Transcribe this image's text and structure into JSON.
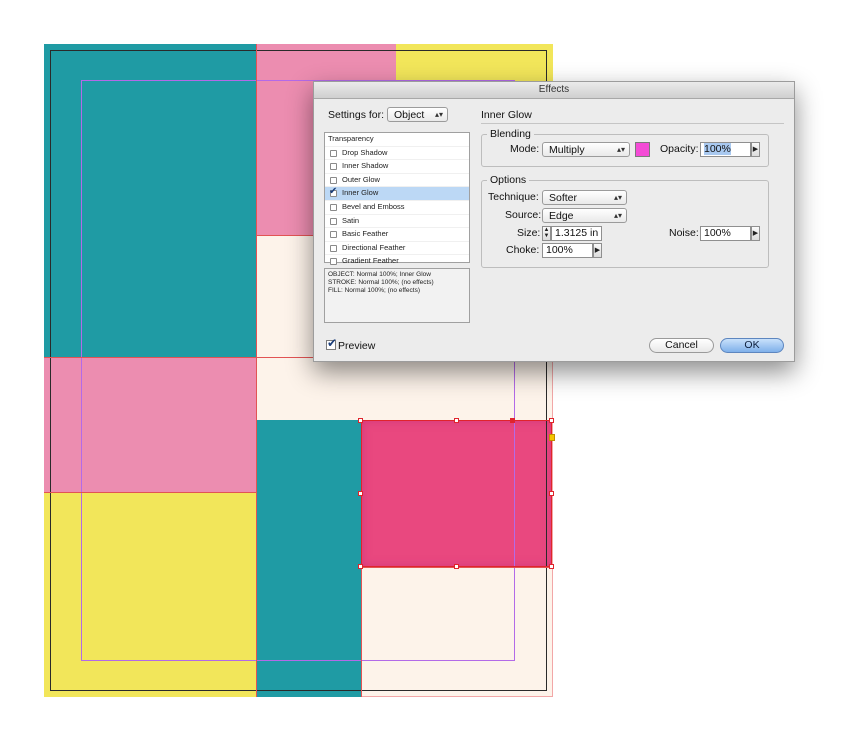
{
  "colors": {
    "teal": "#1f9ba4",
    "pink": "#ec8db0",
    "yellow": "#f2e65a",
    "cream": "#fdf3ea",
    "hot_pink": "#e9487f",
    "glow_swatch": "#f44bd6"
  },
  "dialog": {
    "title": "Effects",
    "settings_for_label": "Settings for:",
    "settings_for_value": "Object",
    "panel_title": "Inner Glow",
    "effects_list": [
      {
        "label": "Transparency",
        "checkbox": false,
        "checked": false,
        "selected": false
      },
      {
        "label": "Drop Shadow",
        "checkbox": true,
        "checked": false,
        "selected": false
      },
      {
        "label": "Inner Shadow",
        "checkbox": true,
        "checked": false,
        "selected": false
      },
      {
        "label": "Outer Glow",
        "checkbox": true,
        "checked": false,
        "selected": false
      },
      {
        "label": "Inner Glow",
        "checkbox": true,
        "checked": true,
        "selected": true
      },
      {
        "label": "Bevel and Emboss",
        "checkbox": true,
        "checked": false,
        "selected": false
      },
      {
        "label": "Satin",
        "checkbox": true,
        "checked": false,
        "selected": false
      },
      {
        "label": "Basic Feather",
        "checkbox": true,
        "checked": false,
        "selected": false
      },
      {
        "label": "Directional Feather",
        "checkbox": true,
        "checked": false,
        "selected": false
      },
      {
        "label": "Gradient Feather",
        "checkbox": true,
        "checked": false,
        "selected": false
      }
    ],
    "summary_lines": [
      "OBJECT: Normal 100%; Inner Glow",
      "STROKE: Normal 100%; (no effects)",
      "FILL: Normal 100%; (no effects)"
    ],
    "blending": {
      "group_label": "Blending",
      "mode_label": "Mode:",
      "mode_value": "Multiply",
      "opacity_label": "Opacity:",
      "opacity_value": "100%"
    },
    "options": {
      "group_label": "Options",
      "technique_label": "Technique:",
      "technique_value": "Softer",
      "source_label": "Source:",
      "source_value": "Edge",
      "size_label": "Size:",
      "size_value": "1.3125 in",
      "noise_label": "Noise:",
      "noise_value": "100%",
      "choke_label": "Choke:",
      "choke_value": "100%"
    },
    "preview_label": "Preview",
    "preview_checked": true,
    "cancel_label": "Cancel",
    "ok_label": "OK"
  }
}
